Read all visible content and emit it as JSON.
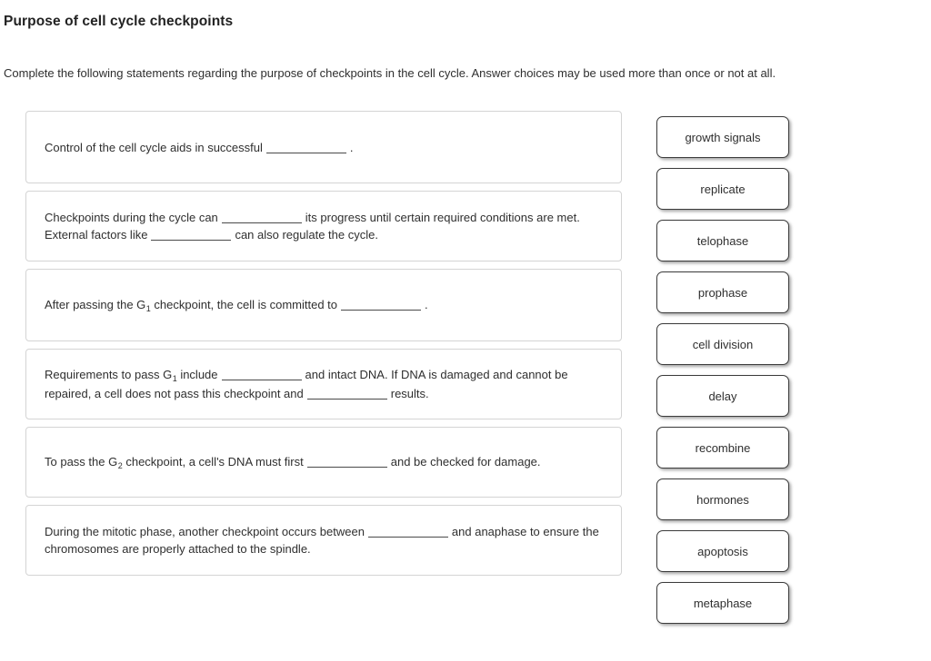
{
  "header": {
    "title": "Purpose of cell cycle checkpoints",
    "instructions": "Complete the following statements regarding the purpose of checkpoints in the cell cycle. Answer choices may be used more than once or not at all."
  },
  "statements": [
    {
      "id": "statement-1",
      "size": "h1",
      "parts": [
        {
          "type": "text",
          "value": "Control of the cell cycle aids in successful"
        },
        {
          "type": "blank"
        },
        {
          "type": "text",
          "value": "."
        }
      ]
    },
    {
      "id": "statement-2",
      "size": "h2",
      "parts": [
        {
          "type": "text",
          "value": "Checkpoints during the cycle can"
        },
        {
          "type": "blank"
        },
        {
          "type": "text",
          "value": "its progress until certain required conditions are met. External factors like"
        },
        {
          "type": "blank"
        },
        {
          "type": "text",
          "value": "can also regulate the cycle."
        }
      ]
    },
    {
      "id": "statement-3",
      "size": "h3",
      "parts": [
        {
          "type": "text",
          "value": "After passing the G"
        },
        {
          "type": "sub",
          "value": "1"
        },
        {
          "type": "text",
          "value": " checkpoint, the cell is committed to"
        },
        {
          "type": "blank"
        },
        {
          "type": "text",
          "value": "."
        }
      ]
    },
    {
      "id": "statement-4",
      "size": "h2",
      "parts": [
        {
          "type": "text",
          "value": "Requirements to pass G"
        },
        {
          "type": "sub",
          "value": "1"
        },
        {
          "type": "text",
          "value": " include"
        },
        {
          "type": "blank"
        },
        {
          "type": "text",
          "value": "and intact DNA. If DNA is damaged and cannot be repaired, a cell does not pass this checkpoint and"
        },
        {
          "type": "blank"
        },
        {
          "type": "text",
          "value": "results."
        }
      ]
    },
    {
      "id": "statement-5",
      "size": "h2",
      "parts": [
        {
          "type": "text",
          "value": "To pass the G"
        },
        {
          "type": "sub",
          "value": "2"
        },
        {
          "type": "text",
          "value": " checkpoint, a cell's DNA must first"
        },
        {
          "type": "blank"
        },
        {
          "type": "text",
          "value": "and be checked for damage."
        }
      ]
    },
    {
      "id": "statement-6",
      "size": "h2",
      "parts": [
        {
          "type": "text",
          "value": "During the mitotic phase, another checkpoint occurs between"
        },
        {
          "type": "blank"
        },
        {
          "type": "text",
          "value": "and anaphase to ensure the chromosomes are properly attached to the spindle."
        }
      ]
    }
  ],
  "choices": [
    {
      "id": "choice-growth-signals",
      "label": "growth signals"
    },
    {
      "id": "choice-replicate",
      "label": "replicate"
    },
    {
      "id": "choice-telophase",
      "label": "telophase"
    },
    {
      "id": "choice-prophase",
      "label": "prophase"
    },
    {
      "id": "choice-cell-division",
      "label": "cell division"
    },
    {
      "id": "choice-delay",
      "label": "delay"
    },
    {
      "id": "choice-recombine",
      "label": "recombine"
    },
    {
      "id": "choice-hormones",
      "label": "hormones"
    },
    {
      "id": "choice-apoptosis",
      "label": "apoptosis"
    },
    {
      "id": "choice-metaphase",
      "label": "metaphase"
    }
  ]
}
